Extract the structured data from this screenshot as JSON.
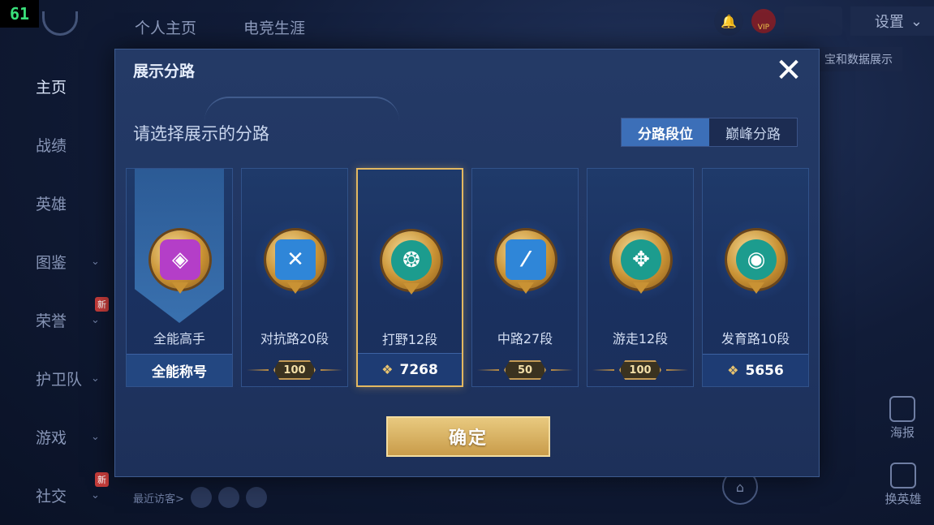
{
  "fps_counter": "61",
  "background": {
    "top_tabs": [
      "个人主页",
      "电竞生涯"
    ],
    "nav": [
      {
        "label": "主页",
        "active": true,
        "chevron": false,
        "new": false
      },
      {
        "label": "战绩",
        "active": false,
        "chevron": false,
        "new": false
      },
      {
        "label": "英雄",
        "active": false,
        "chevron": false,
        "new": false
      },
      {
        "label": "图鉴",
        "active": false,
        "chevron": true,
        "new": false
      },
      {
        "label": "荣誉",
        "active": false,
        "chevron": true,
        "new": true
      },
      {
        "label": "护卫队",
        "active": false,
        "chevron": true,
        "new": false
      },
      {
        "label": "游戏",
        "active": false,
        "chevron": true,
        "new": false
      },
      {
        "label": "社交",
        "active": false,
        "chevron": true,
        "new": true
      }
    ],
    "new_badge": "新",
    "vip_label": "VIP",
    "settings_label": "设置",
    "data_show_label": "宝和数据展示",
    "poster_label": "海报",
    "swap_hero_label": "换英雄",
    "recent_visitors_label": "最近访客>"
  },
  "modal": {
    "title": "展示分路",
    "subtitle": "请选择展示的分路",
    "toggle": {
      "active": "分路段位",
      "inactive": "巅峰分路"
    },
    "confirm_label": "确定",
    "cards": [
      {
        "name": "全能高手",
        "footer_type": "title",
        "footer": "全能称号",
        "badge_color": "purple",
        "glyph": "◈",
        "selected": false
      },
      {
        "name": "对抗路20段",
        "footer_type": "stars",
        "footer": "100",
        "badge_color": "blue",
        "glyph": "✕",
        "selected": false
      },
      {
        "name": "打野12段",
        "footer_type": "peak",
        "footer": "7268",
        "badge_color": "teal",
        "glyph": "❂",
        "selected": true
      },
      {
        "name": "中路27段",
        "footer_type": "stars",
        "footer": "50",
        "badge_color": "blue",
        "glyph": "⁄",
        "selected": false
      },
      {
        "name": "游走12段",
        "footer_type": "stars",
        "footer": "100",
        "badge_color": "teal",
        "glyph": "✥",
        "selected": false
      },
      {
        "name": "发育路10段",
        "footer_type": "peak",
        "footer": "5656",
        "badge_color": "teal",
        "glyph": "◉",
        "selected": false
      }
    ]
  }
}
